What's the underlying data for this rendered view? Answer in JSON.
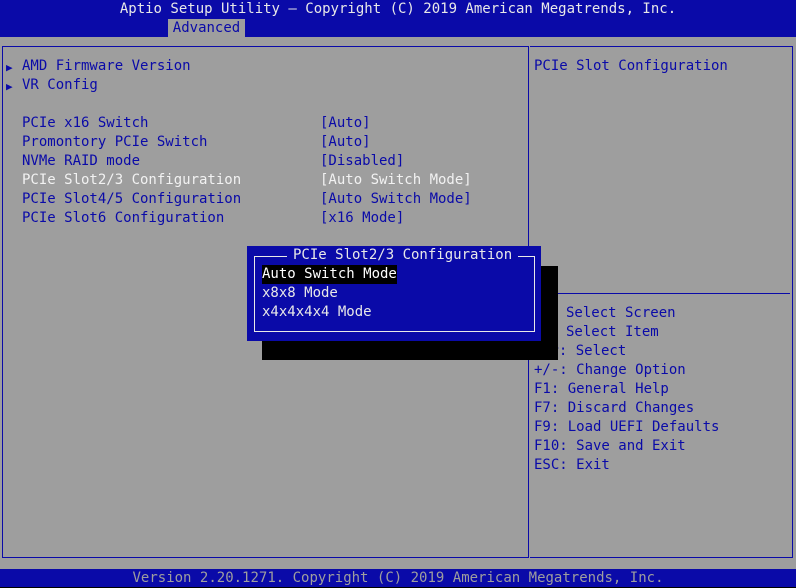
{
  "header": {
    "title": "Aptio Setup Utility – Copyright (C) 2019 American Megatrends, Inc.",
    "active_tab": "Advanced"
  },
  "menu": {
    "submenus": [
      {
        "label": "AMD Firmware Version"
      },
      {
        "label": "VR Config"
      }
    ],
    "settings": [
      {
        "label": "PCIe x16 Switch",
        "value": "[Auto]"
      },
      {
        "label": "Promontory PCIe Switch",
        "value": "[Auto]"
      },
      {
        "label": "NVMe RAID mode",
        "value": "[Disabled]"
      },
      {
        "label": "PCIe Slot2/3 Configuration",
        "value": "[Auto Switch Mode]",
        "selected": true
      },
      {
        "label": "PCIe Slot4/5 Configuration",
        "value": "[Auto Switch Mode]"
      },
      {
        "label": "PCIe Slot6 Configuration",
        "value": "[x16 Mode]"
      }
    ]
  },
  "help_panel": {
    "description": "PCIe Slot Configuration",
    "keys": [
      "Select Screen",
      "Select Item",
      "er: Select",
      "+/-: Change Option",
      "F1: General Help",
      "F7: Discard Changes",
      "F9: Load UEFI Defaults",
      "F10: Save and Exit",
      "ESC: Exit"
    ]
  },
  "popup": {
    "title": "PCIe Slot2/3 Configuration",
    "options": [
      {
        "label": "Auto Switch Mode",
        "selected": true
      },
      {
        "label": "x8x8 Mode"
      },
      {
        "label": "x4x4x4x4 Mode"
      }
    ]
  },
  "footer": {
    "text": "Version 2.20.1271. Copyright (C) 2019 American Megatrends, Inc."
  },
  "colors": {
    "bios_blue": "#0A0AA8",
    "panel_gray": "#9E9E9E",
    "highlight_white": "#F2F2F2"
  }
}
